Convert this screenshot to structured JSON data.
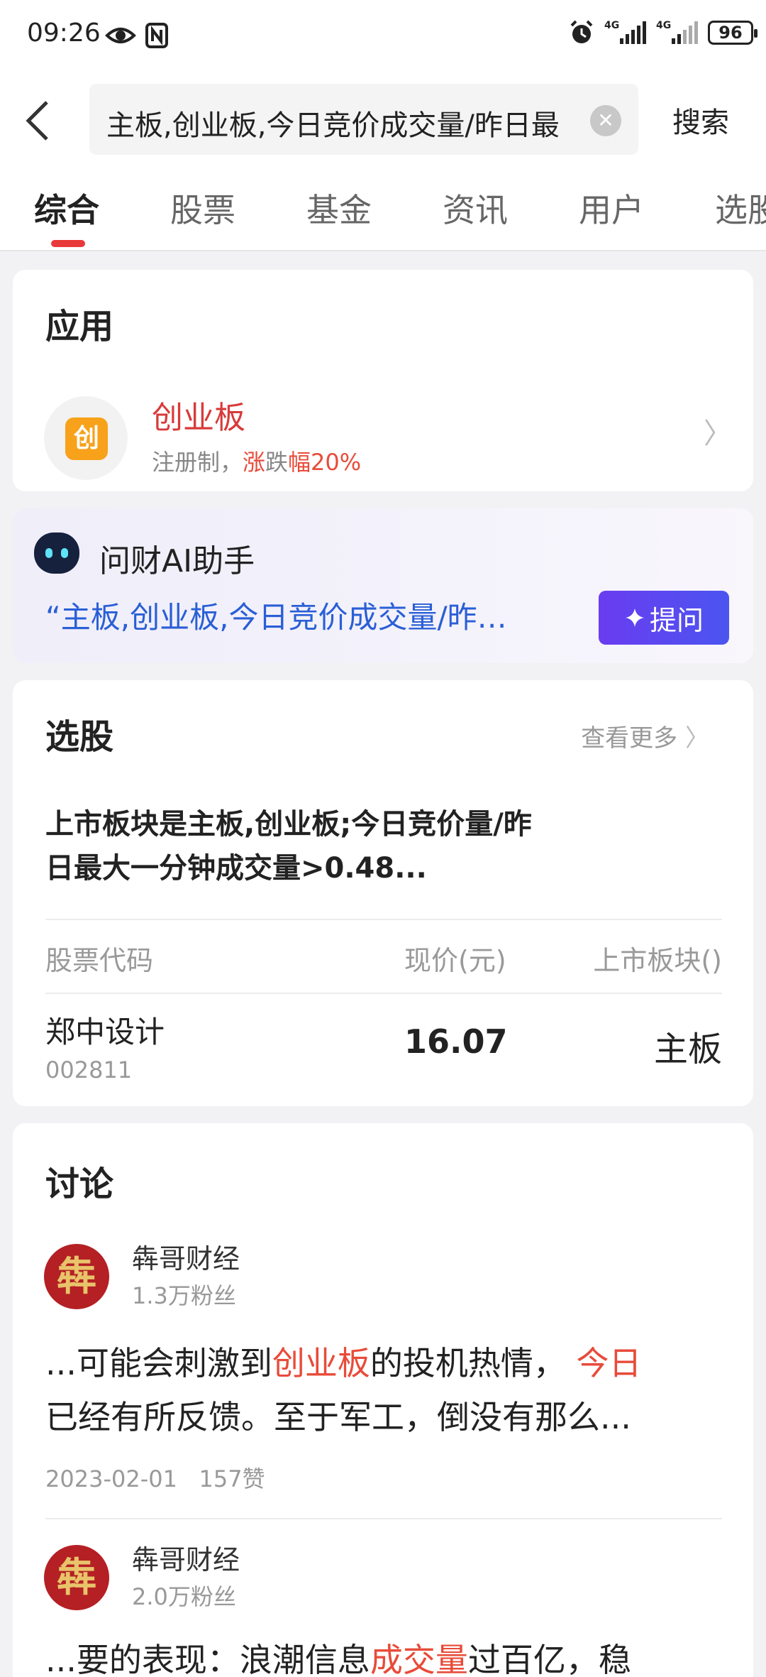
{
  "status": {
    "time": "09:26",
    "net1": "4G",
    "net2": "4G",
    "battery": "96"
  },
  "search": {
    "query": "主板,创业板,今日竞价成交量/昨日最",
    "button": "搜索"
  },
  "tabs": [
    {
      "label": "综合"
    },
    {
      "label": "股票"
    },
    {
      "label": "基金"
    },
    {
      "label": "资讯"
    },
    {
      "label": "用户"
    },
    {
      "label": "选股"
    }
  ],
  "app_section": {
    "title": "应用",
    "item": {
      "icon_char": "创",
      "name": "创业板",
      "desc_prefix": "注册制，",
      "desc_hl1": "涨",
      "desc_mid": "跌",
      "desc_hl2": "幅20%"
    }
  },
  "ai": {
    "title": "问财AI助手",
    "quote": "“主板,创业板,今日竞价成交量/昨…",
    "button": "提问"
  },
  "stock_pick": {
    "title": "选股",
    "more": "查看更多",
    "query": "上市板块是主板,创业板;今日竞价量/昨日最大一分钟成交量>0.48...",
    "headers": {
      "code": "股票代码",
      "price": "现价(元)",
      "board": "上市板块()"
    },
    "row": {
      "name": "郑中设计",
      "code": "002811",
      "price": "16.07",
      "board": "主板"
    }
  },
  "discussion": {
    "title": "讨论",
    "posts": [
      {
        "avatar": "犇",
        "author": "犇哥财经",
        "fans": "1.3万粉丝",
        "t1": "...可能会刺激到",
        "h1": "创业板",
        "t2": "的投机热情，",
        "h2": "今日",
        "t3": "已经有所反馈。至于军工，倒没有那么...",
        "date": "2023-02-01",
        "likes": "157赞"
      },
      {
        "avatar": "犇",
        "author": "犇哥财经",
        "fans": "2.0万粉丝",
        "t1": "...要的表现：浪潮信息",
        "h1": "成交量",
        "t2": "过百亿，稳"
      }
    ]
  }
}
